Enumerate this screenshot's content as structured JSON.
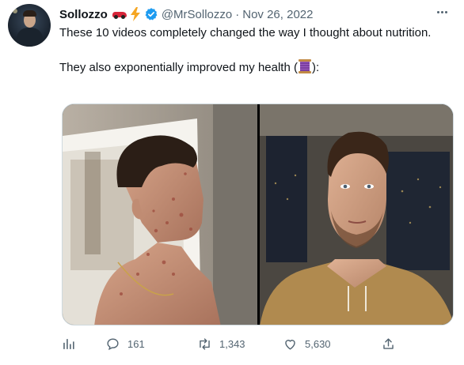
{
  "tweet": {
    "author": {
      "name": "Sollozzo",
      "handle": "@MrSollozzo",
      "verified": true,
      "name_emojis": [
        "red-car-emoji",
        "lightning-bolt-emoji"
      ],
      "avatar_icon": "profile-avatar"
    },
    "separator": "·",
    "date": "Nov 26, 2022",
    "text": {
      "line1": "These 10 videos completely changed the way I thought about nutrition.",
      "line2_prefix": "They also exponentially improved my health (",
      "line2_emoji": "thread-spool-emoji",
      "line2_suffix": "):"
    },
    "media": {
      "left_image": "before-photo",
      "right_image": "after-photo"
    },
    "actions": {
      "analytics_icon": "bar-chart-icon",
      "replies": "161",
      "retweets": "1,343",
      "likes": "5,630",
      "share_icon": "share-icon"
    }
  },
  "colors": {
    "text_primary": "#0f1419",
    "text_secondary": "#536471",
    "verified_blue": "#1d9bf0",
    "border": "#cfd9de"
  }
}
